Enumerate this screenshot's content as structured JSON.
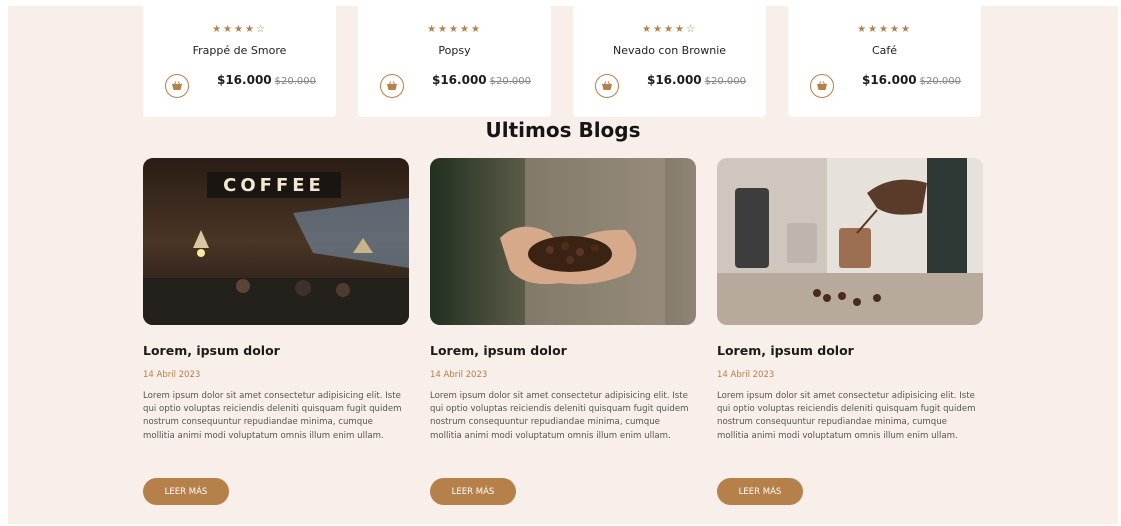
{
  "products": [
    {
      "name": "Frappé de Smore",
      "rating": 4,
      "price": "$16.000",
      "old_price": "$20.000"
    },
    {
      "name": "Popsy",
      "rating": 5,
      "price": "$16.000",
      "old_price": "$20.000"
    },
    {
      "name": "Nevado con Brownie",
      "rating": 4,
      "price": "$16.000",
      "old_price": "$20.000"
    },
    {
      "name": "Café",
      "rating": 5,
      "price": "$16.000",
      "old_price": "$20.000"
    }
  ],
  "blogs_section": {
    "title": "Ultimos Blogs",
    "posts": [
      {
        "title": "Lorem, ipsum dolor",
        "date": "14 Abril 2023",
        "text": "Lorem ipsum dolor sit amet consectetur adipisicing elit. Iste qui optio voluptas reiciendis deleniti quisquam fugit quidem nostrum consequuntur repudiandae minima, cumque mollitia animi modi voluptatum omnis illum enim ullam.",
        "button": "LEER MÁS",
        "image_text": "COFFEE"
      },
      {
        "title": "Lorem, ipsum dolor",
        "date": "14 Abril 2023",
        "text": "Lorem ipsum dolor sit amet consectetur adipisicing elit. Iste qui optio voluptas reiciendis deleniti quisquam fugit quidem nostrum consequuntur repudiandae minima, cumque mollitia animi modi voluptatum omnis illum enim ullam.",
        "button": "LEER MÁS"
      },
      {
        "title": "Lorem, ipsum dolor",
        "date": "14 Abril 2023",
        "text": "Lorem ipsum dolor sit amet consectetur adipisicing elit. Iste qui optio voluptas reiciendis deleniti quisquam fugit quidem nostrum consequuntur repudiandae minima, cumque mollitia animi modi voluptatum omnis illum enim ullam.",
        "button": "LEER MÁS"
      }
    ]
  },
  "colors": {
    "accent": "#b5804a",
    "background": "#f8eeea",
    "card": "#ffffff"
  },
  "icons": {
    "cart": "basket-icon",
    "star": "star-icon"
  }
}
